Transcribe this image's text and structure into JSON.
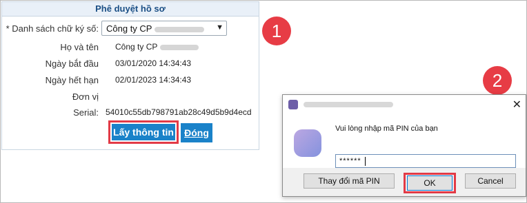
{
  "panel": {
    "title": "Phê duyệt hồ sơ",
    "cert_list_label": "* Danh sách chữ ký số:",
    "cert_select_value": "Công ty CP",
    "fields": [
      {
        "label": "Họ và tên",
        "value": "Công ty CP"
      },
      {
        "label": "Ngày bắt đầu",
        "value": "03/01/2020 14:34:43"
      },
      {
        "label": "Ngày hết hạn",
        "value": "02/01/2023 14:34:43"
      },
      {
        "label": "Đơn vị",
        "value": ""
      },
      {
        "label": "Serial:",
        "value": "54010c55db798791ab28c49d5b9d4ecd"
      }
    ],
    "get_info_button": "Lấy thông tin",
    "close_button": "Đóng"
  },
  "badges": [
    "1",
    "2"
  ],
  "dialog": {
    "prompt": "Vui lòng nhập mã PIN của bạn",
    "pin_value": "******",
    "change_pin_button": "Thay đổi mã PIN",
    "ok_button": "OK",
    "cancel_button": "Cancel",
    "close_glyph": "✕"
  },
  "colors": {
    "accent": "#1a82c9",
    "highlight": "#e23a46",
    "title_text": "#1b4f85"
  }
}
